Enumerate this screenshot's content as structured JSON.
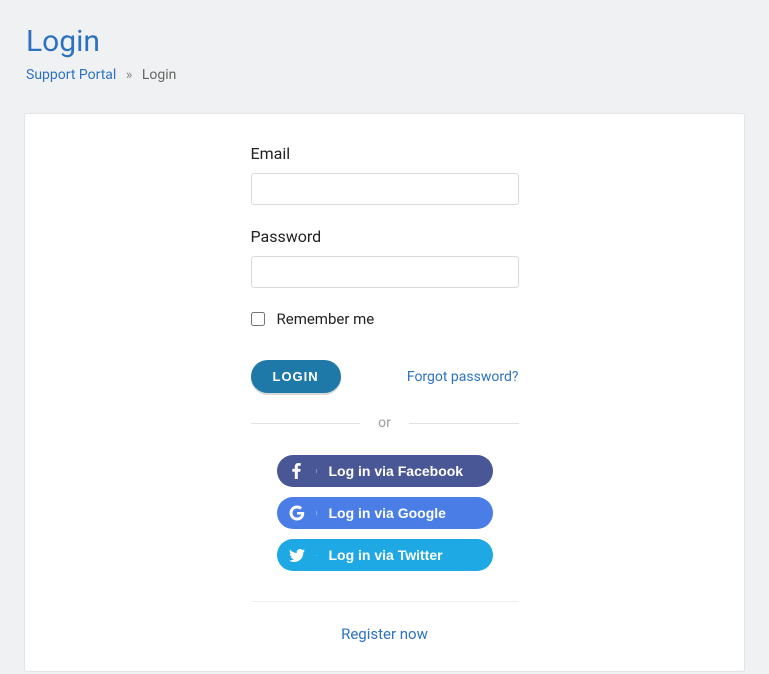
{
  "header": {
    "title": "Login",
    "breadcrumb": {
      "root": "Support Portal",
      "current": "Login"
    }
  },
  "form": {
    "email_label": "Email",
    "email_value": "",
    "password_label": "Password",
    "password_value": "",
    "remember_label": "Remember me",
    "login_button": "LOGIN",
    "forgot_link": "Forgot password?",
    "divider_text": "or"
  },
  "social": {
    "facebook": "Log in via Facebook",
    "google": "Log in via Google",
    "twitter": "Log in via Twitter"
  },
  "register_link": "Register now"
}
